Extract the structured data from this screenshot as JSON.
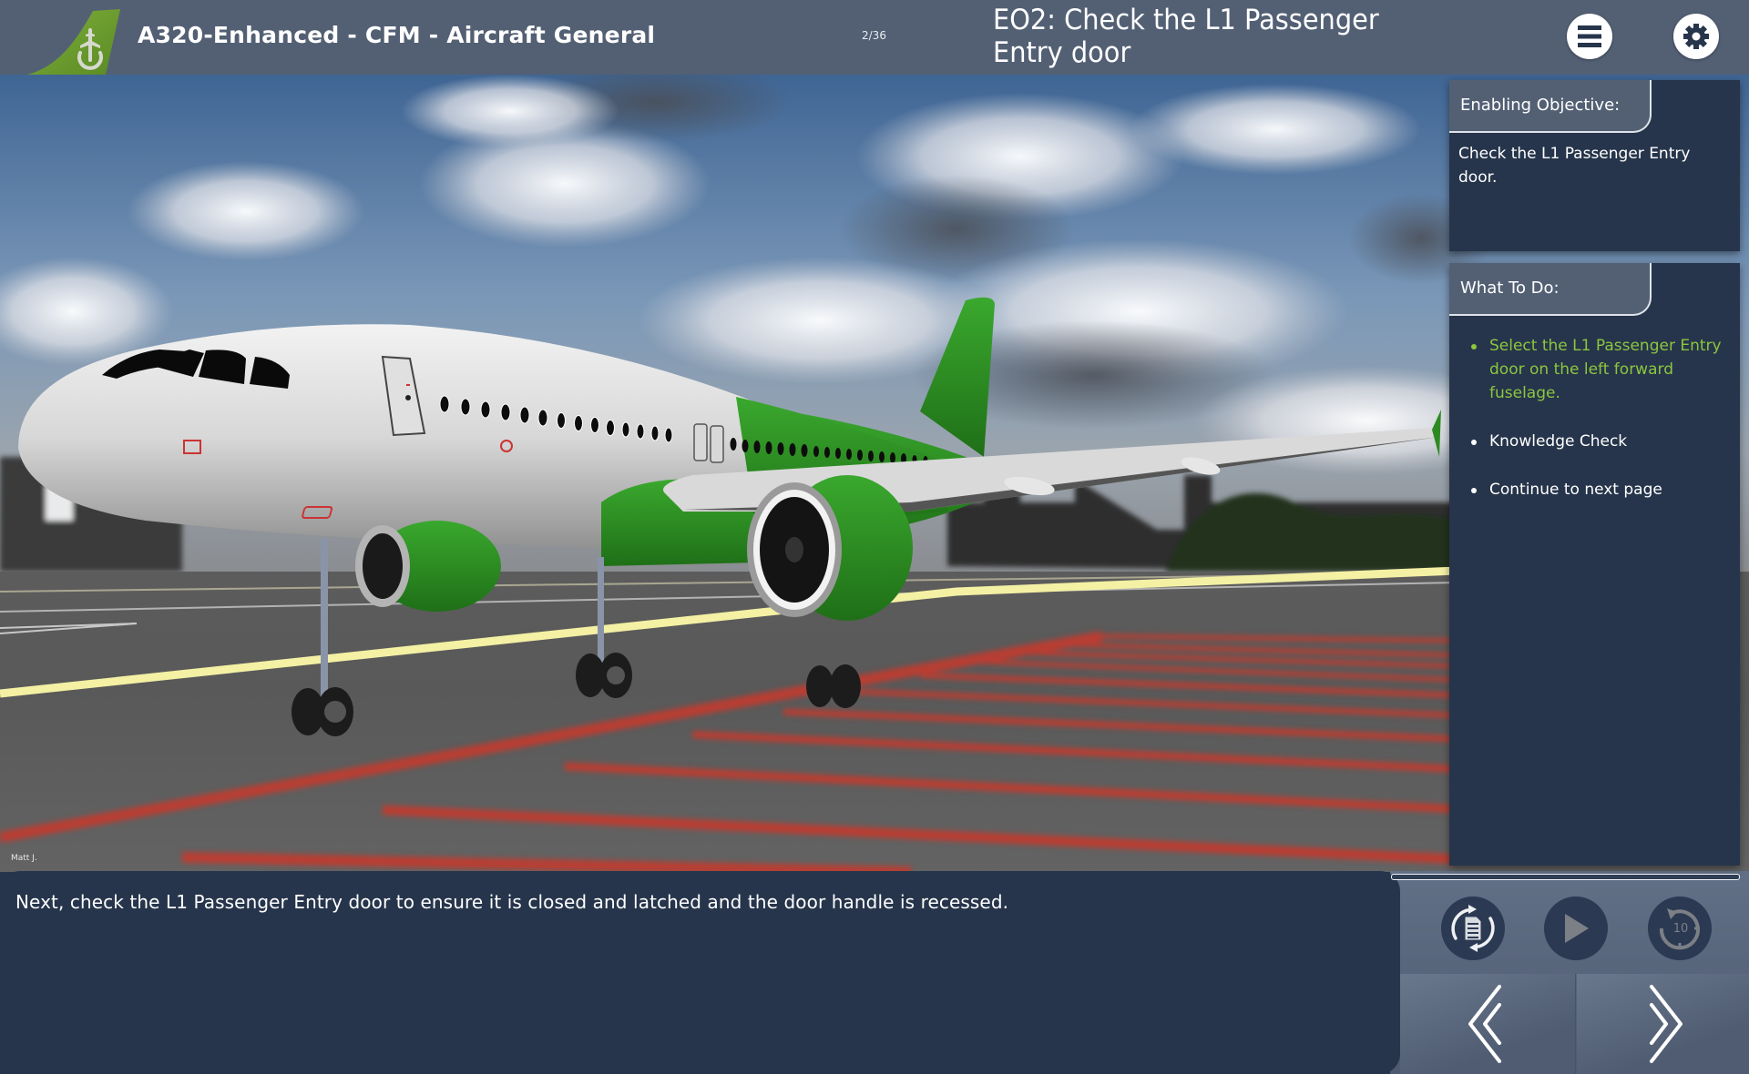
{
  "header": {
    "logo_icon": "aircraft-tail-logo-icon",
    "app_title": "A320-Enhanced - CFM - Aircraft General",
    "page_counter": "2/36",
    "lesson_title": "EO2: Check the L1 Passenger Entry door",
    "menu_icon": "hamburger-menu-icon",
    "settings_icon": "gear-icon"
  },
  "scene": {
    "description": "3D view of A320 aircraft (green/white livery) on apron",
    "credit": "Matt J."
  },
  "objective_panel": {
    "title": "Enabling Objective:",
    "body": "Check the L1 Passenger Entry door."
  },
  "todo_panel": {
    "title": "What To Do:",
    "items": [
      {
        "label": "Select the L1 Passenger Entry door on the left forward fuselage.",
        "active": true
      },
      {
        "label": "Knowledge Check",
        "active": false
      },
      {
        "label": "Continue to next page",
        "active": false
      }
    ]
  },
  "narration": {
    "text": "Next, check the L1 Passenger Entry door to ensure it is closed and latched and the door handle is recessed."
  },
  "controls": {
    "progress_percent": 0,
    "transcript_icon": "transcript-refresh-icon",
    "play_icon": "play-icon",
    "replay_icon": "replay-10-icon",
    "prev_icon": "double-chevron-left-icon",
    "next_icon": "double-chevron-right-icon"
  },
  "colors": {
    "header_bg": "#536074",
    "panel_bg": "#26354b",
    "accent_green": "#8cc63f",
    "logo_green": "#6a9a2c"
  }
}
